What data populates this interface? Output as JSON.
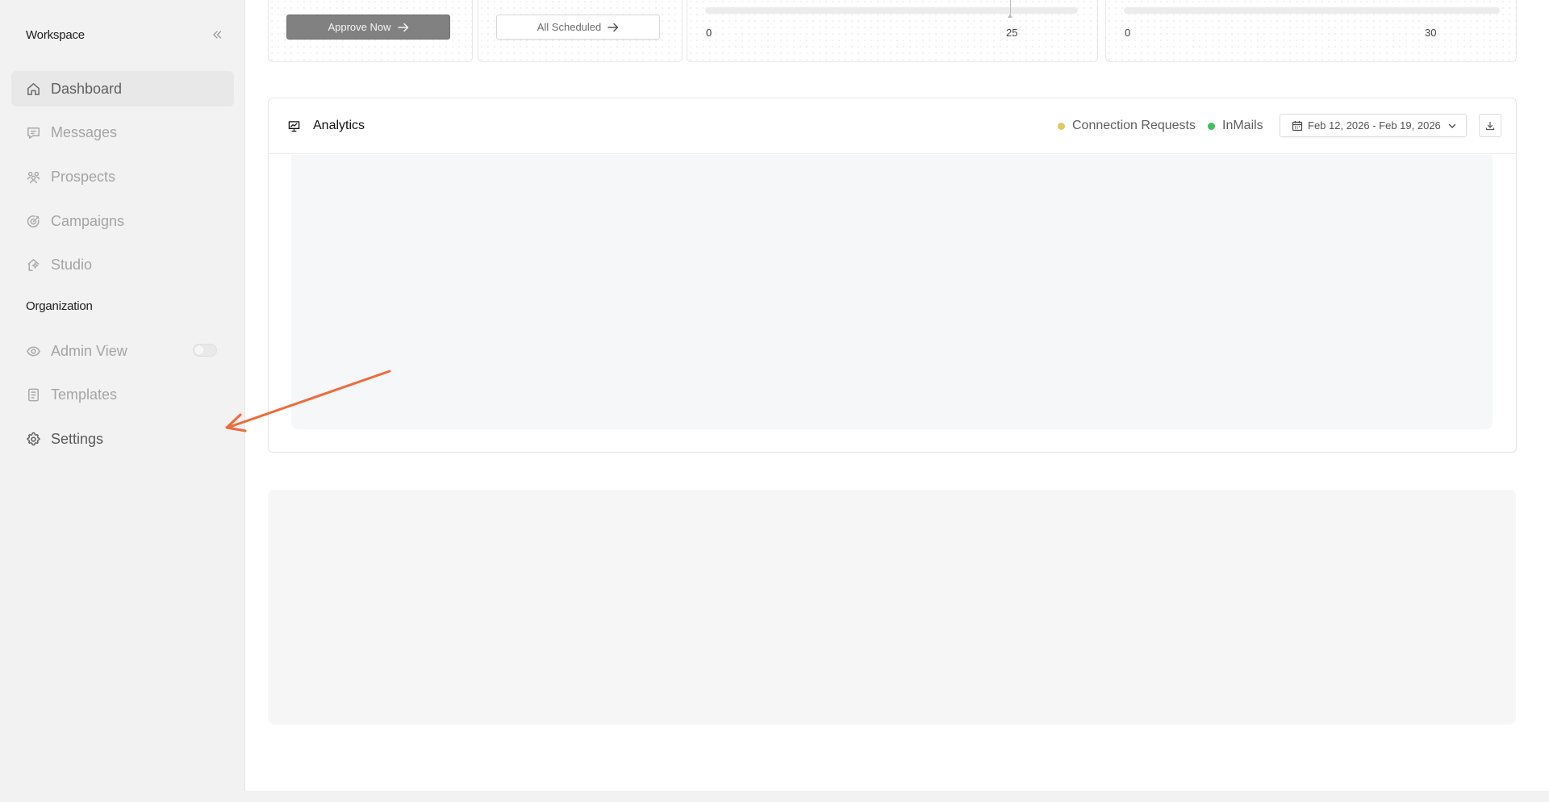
{
  "sidebar": {
    "workspace_title": "Workspace",
    "organization_title": "Organization",
    "items": [
      {
        "label": "Dashboard",
        "icon": "home-icon"
      },
      {
        "label": "Messages",
        "icon": "message-icon"
      },
      {
        "label": "Prospects",
        "icon": "users-icon"
      },
      {
        "label": "Campaigns",
        "icon": "target-icon"
      },
      {
        "label": "Studio",
        "icon": "studio-home-icon"
      }
    ],
    "org_items": [
      {
        "label": "Admin View",
        "icon": "eye-icon",
        "toggle": "off"
      },
      {
        "label": "Templates",
        "icon": "document-icon"
      },
      {
        "label": "Settings",
        "icon": "gear-icon"
      }
    ]
  },
  "cards": {
    "approve_label": "Approve Now",
    "scheduled_label": "All Scheduled",
    "range1": {
      "min": "0",
      "mark": "25"
    },
    "range2": {
      "min": "0",
      "max": "30"
    }
  },
  "analytics": {
    "title": "Analytics",
    "legend": [
      {
        "label": "Connection Requests",
        "color": "#e3c766"
      },
      {
        "label": "InMails",
        "color": "#3ec15a"
      }
    ],
    "date_range": "Feb 12, 2026 - Feb 19, 2026"
  },
  "annotation": {
    "color": "#f06a3c"
  }
}
